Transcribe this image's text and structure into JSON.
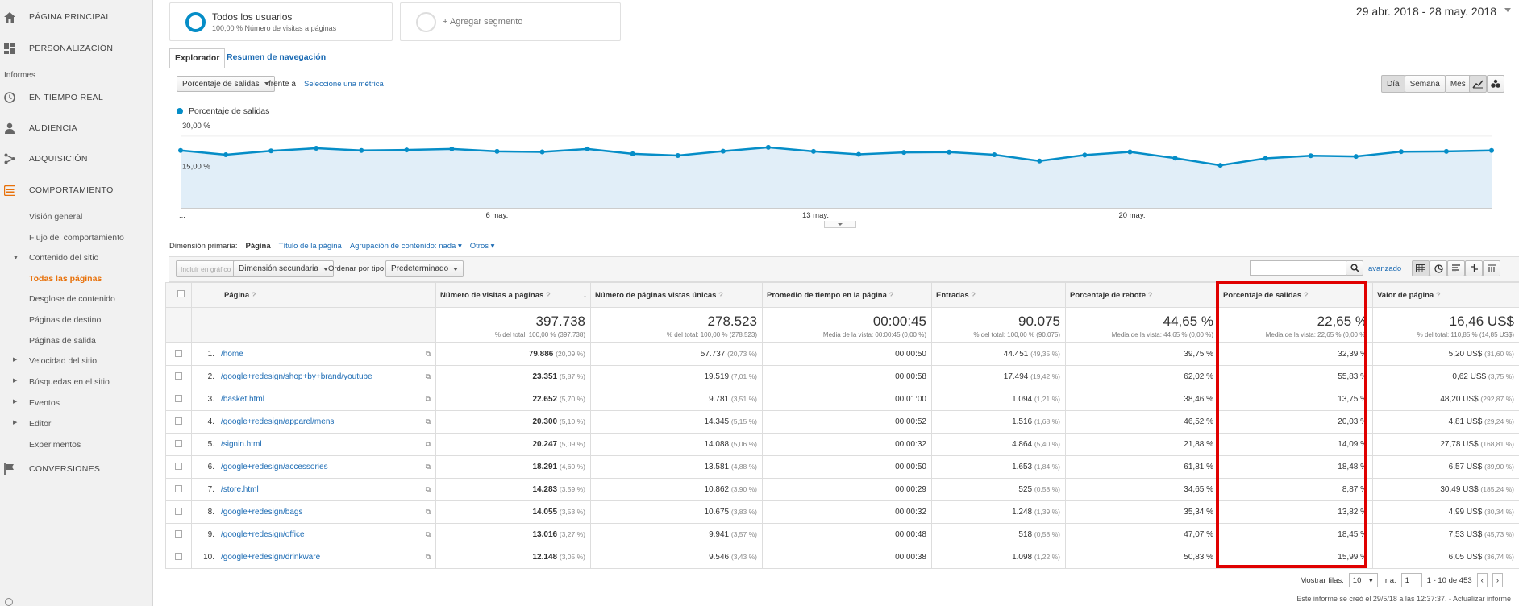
{
  "sidebar": {
    "items": [
      {
        "label": "PÁGINA PRINCIPAL",
        "icon": "home-icon"
      },
      {
        "label": "PERSONALIZACIÓN",
        "icon": "dashboard-icon"
      },
      {
        "label": "EN TIEMPO REAL",
        "icon": "clock-icon"
      },
      {
        "label": "AUDIENCIA",
        "icon": "person-icon"
      },
      {
        "label": "ADQUISICIÓN",
        "icon": "acquisition-icon"
      },
      {
        "label": "COMPORTAMIENTO",
        "icon": "behavior-icon"
      },
      {
        "label": "CONVERSIONES",
        "icon": "flag-icon"
      }
    ],
    "section_label": "Informes",
    "behavior_sub": [
      {
        "label": "Visión general"
      },
      {
        "label": "Flujo del comportamiento"
      },
      {
        "label": "Contenido del sitio"
      },
      {
        "label": "Todas las páginas"
      },
      {
        "label": "Desglose de contenido"
      },
      {
        "label": "Páginas de destino"
      },
      {
        "label": "Páginas de salida"
      },
      {
        "label": "Velocidad del sitio"
      },
      {
        "label": "Búsquedas en el sitio"
      },
      {
        "label": "Eventos"
      },
      {
        "label": "Editor"
      },
      {
        "label": "Experimentos"
      }
    ]
  },
  "segments": {
    "active_title": "Todos los usuarios",
    "active_sub": "100,00 % Número de visitas a páginas",
    "add_label": "+ Agregar segmento"
  },
  "date_range": "29 abr. 2018 - 28 may. 2018",
  "tabs": [
    "Explorador",
    "Resumen de navegación"
  ],
  "metric_bar": {
    "metric": "Porcentaje de salidas",
    "vs": "frente a",
    "select_metric": "Seleccione una métrica",
    "periods": [
      "Día",
      "Semana",
      "Mes"
    ]
  },
  "chart_data": {
    "type": "area",
    "series": [
      {
        "name": "Porcentaje de salidas"
      }
    ],
    "y_tick_labels": [
      "30,00 %",
      "15,00 %"
    ],
    "x_tick_labels": [
      "...",
      "6 may.",
      "13 may.",
      "20 may."
    ],
    "x": [
      "29 abr.",
      "30 abr.",
      "1 may.",
      "2 may.",
      "3 may.",
      "4 may.",
      "5 may.",
      "6 may.",
      "7 may.",
      "8 may.",
      "9 may.",
      "10 may.",
      "11 may.",
      "12 may.",
      "13 may.",
      "14 may.",
      "15 may.",
      "16 may.",
      "17 may.",
      "18 may.",
      "19 may.",
      "20 may.",
      "21 may.",
      "22 may.",
      "23 may.",
      "24 may.",
      "25 may.",
      "26 may.",
      "27 may.",
      "28 may."
    ],
    "values": [
      24.0,
      22.2,
      23.8,
      24.9,
      24.0,
      24.2,
      24.6,
      23.6,
      23.4,
      24.6,
      22.6,
      21.9,
      23.7,
      25.3,
      23.6,
      22.4,
      23.2,
      23.3,
      22.2,
      19.6,
      22.1,
      23.4,
      20.8,
      17.8,
      20.7,
      21.8,
      21.5,
      23.5,
      23.6,
      24.0
    ],
    "ylim": [
      0,
      34
    ],
    "color": "#058dc7",
    "fill": "#e1eef8"
  },
  "dimension": {
    "label": "Dimensión primaria:",
    "primary": "Página",
    "options": [
      "Título de la página",
      "Agrupación de contenido: nada",
      "Otros"
    ]
  },
  "toolbar": {
    "plot_rows": "Incluir en gráfico",
    "secondary": "Dimensión secundaria",
    "sort_label": "Ordenar por tipo:",
    "sort_value": "Predeterminado",
    "advanced": "avanzado"
  },
  "table": {
    "headers": [
      "Página",
      "Número de visitas a páginas",
      "Número de páginas vistas únicas",
      "Promedio de tiempo en la página",
      "Entradas",
      "Porcentaje de rebote",
      "Porcentaje de salidas",
      "Valor de página"
    ],
    "totals": [
      {
        "big": "397.738",
        "small": "% del total: 100,00 % (397.738)"
      },
      {
        "big": "278.523",
        "small": "% del total: 100,00 % (278.523)"
      },
      {
        "big": "00:00:45",
        "small": "Media de la vista: 00:00:45 (0,00 %)"
      },
      {
        "big": "90.075",
        "small": "% del total: 100,00 % (90.075)"
      },
      {
        "big": "44,65 %",
        "small": "Media de la vista: 44,65 % (0,00 %)"
      },
      {
        "big": "22,65 %",
        "small": "Media de la vista: 22,65 % (0,00 %)"
      },
      {
        "big": "16,46 US$",
        "small": "% del total: 110,85 % (14,85 US$)"
      }
    ],
    "rows": [
      {
        "n": "1.",
        "page": "/home",
        "views": "79.886",
        "views_pct": "(20,09 %)",
        "uniq": "57.737",
        "uniq_pct": "(20,73 %)",
        "time": "00:00:50",
        "ent": "44.451",
        "ent_pct": "(49,35 %)",
        "bounce": "39,75 %",
        "exit": "32,39 %",
        "val": "5,20 US$",
        "val_pct": "(31,60 %)"
      },
      {
        "n": "2.",
        "page": "/google+redesign/shop+by+brand/youtube",
        "views": "23.351",
        "views_pct": "(5,87 %)",
        "uniq": "19.519",
        "uniq_pct": "(7,01 %)",
        "time": "00:00:58",
        "ent": "17.494",
        "ent_pct": "(19,42 %)",
        "bounce": "62,02 %",
        "exit": "55,83 %",
        "val": "0,62 US$",
        "val_pct": "(3,75 %)"
      },
      {
        "n": "3.",
        "page": "/basket.html",
        "views": "22.652",
        "views_pct": "(5,70 %)",
        "uniq": "9.781",
        "uniq_pct": "(3,51 %)",
        "time": "00:01:00",
        "ent": "1.094",
        "ent_pct": "(1,21 %)",
        "bounce": "38,46 %",
        "exit": "13,75 %",
        "val": "48,20 US$",
        "val_pct": "(292,87 %)"
      },
      {
        "n": "4.",
        "page": "/google+redesign/apparel/mens",
        "views": "20.300",
        "views_pct": "(5,10 %)",
        "uniq": "14.345",
        "uniq_pct": "(5,15 %)",
        "time": "00:00:52",
        "ent": "1.516",
        "ent_pct": "(1,68 %)",
        "bounce": "46,52 %",
        "exit": "20,03 %",
        "val": "4,81 US$",
        "val_pct": "(29,24 %)"
      },
      {
        "n": "5.",
        "page": "/signin.html",
        "views": "20.247",
        "views_pct": "(5,09 %)",
        "uniq": "14.088",
        "uniq_pct": "(5,06 %)",
        "time": "00:00:32",
        "ent": "4.864",
        "ent_pct": "(5,40 %)",
        "bounce": "21,88 %",
        "exit": "14,09 %",
        "val": "27,78 US$",
        "val_pct": "(168,81 %)"
      },
      {
        "n": "6.",
        "page": "/google+redesign/accessories",
        "views": "18.291",
        "views_pct": "(4,60 %)",
        "uniq": "13.581",
        "uniq_pct": "(4,88 %)",
        "time": "00:00:50",
        "ent": "1.653",
        "ent_pct": "(1,84 %)",
        "bounce": "61,81 %",
        "exit": "18,48 %",
        "val": "6,57 US$",
        "val_pct": "(39,90 %)"
      },
      {
        "n": "7.",
        "page": "/store.html",
        "views": "14.283",
        "views_pct": "(3,59 %)",
        "uniq": "10.862",
        "uniq_pct": "(3,90 %)",
        "time": "00:00:29",
        "ent": "525",
        "ent_pct": "(0,58 %)",
        "bounce": "34,65 %",
        "exit": "8,87 %",
        "val": "30,49 US$",
        "val_pct": "(185,24 %)"
      },
      {
        "n": "8.",
        "page": "/google+redesign/bags",
        "views": "14.055",
        "views_pct": "(3,53 %)",
        "uniq": "10.675",
        "uniq_pct": "(3,83 %)",
        "time": "00:00:32",
        "ent": "1.248",
        "ent_pct": "(1,39 %)",
        "bounce": "35,34 %",
        "exit": "13,82 %",
        "val": "4,99 US$",
        "val_pct": "(30,34 %)"
      },
      {
        "n": "9.",
        "page": "/google+redesign/office",
        "views": "13.016",
        "views_pct": "(3,27 %)",
        "uniq": "9.941",
        "uniq_pct": "(3,57 %)",
        "time": "00:00:48",
        "ent": "518",
        "ent_pct": "(0,58 %)",
        "bounce": "47,07 %",
        "exit": "18,45 %",
        "val": "7,53 US$",
        "val_pct": "(45,73 %)"
      },
      {
        "n": "10.",
        "page": "/google+redesign/drinkware",
        "views": "12.148",
        "views_pct": "(3,05 %)",
        "uniq": "9.546",
        "uniq_pct": "(3,43 %)",
        "time": "00:00:38",
        "ent": "1.098",
        "ent_pct": "(1,22 %)",
        "bounce": "50,83 %",
        "exit": "15,99 %",
        "val": "6,05 US$",
        "val_pct": "(36,74 %)"
      }
    ]
  },
  "pager": {
    "show_rows": "Mostrar filas:",
    "rows_value": "10",
    "goto": "Ir a:",
    "goto_value": "1",
    "range": "1 - 10 de 453"
  },
  "footer_note": "Este informe se creó el 29/5/18 a las 12:37:37. - Actualizar informe",
  "colors": {
    "accent": "#e8710a",
    "link": "#1a6ab3",
    "series": "#058dc7",
    "highlight": "#e00000"
  }
}
